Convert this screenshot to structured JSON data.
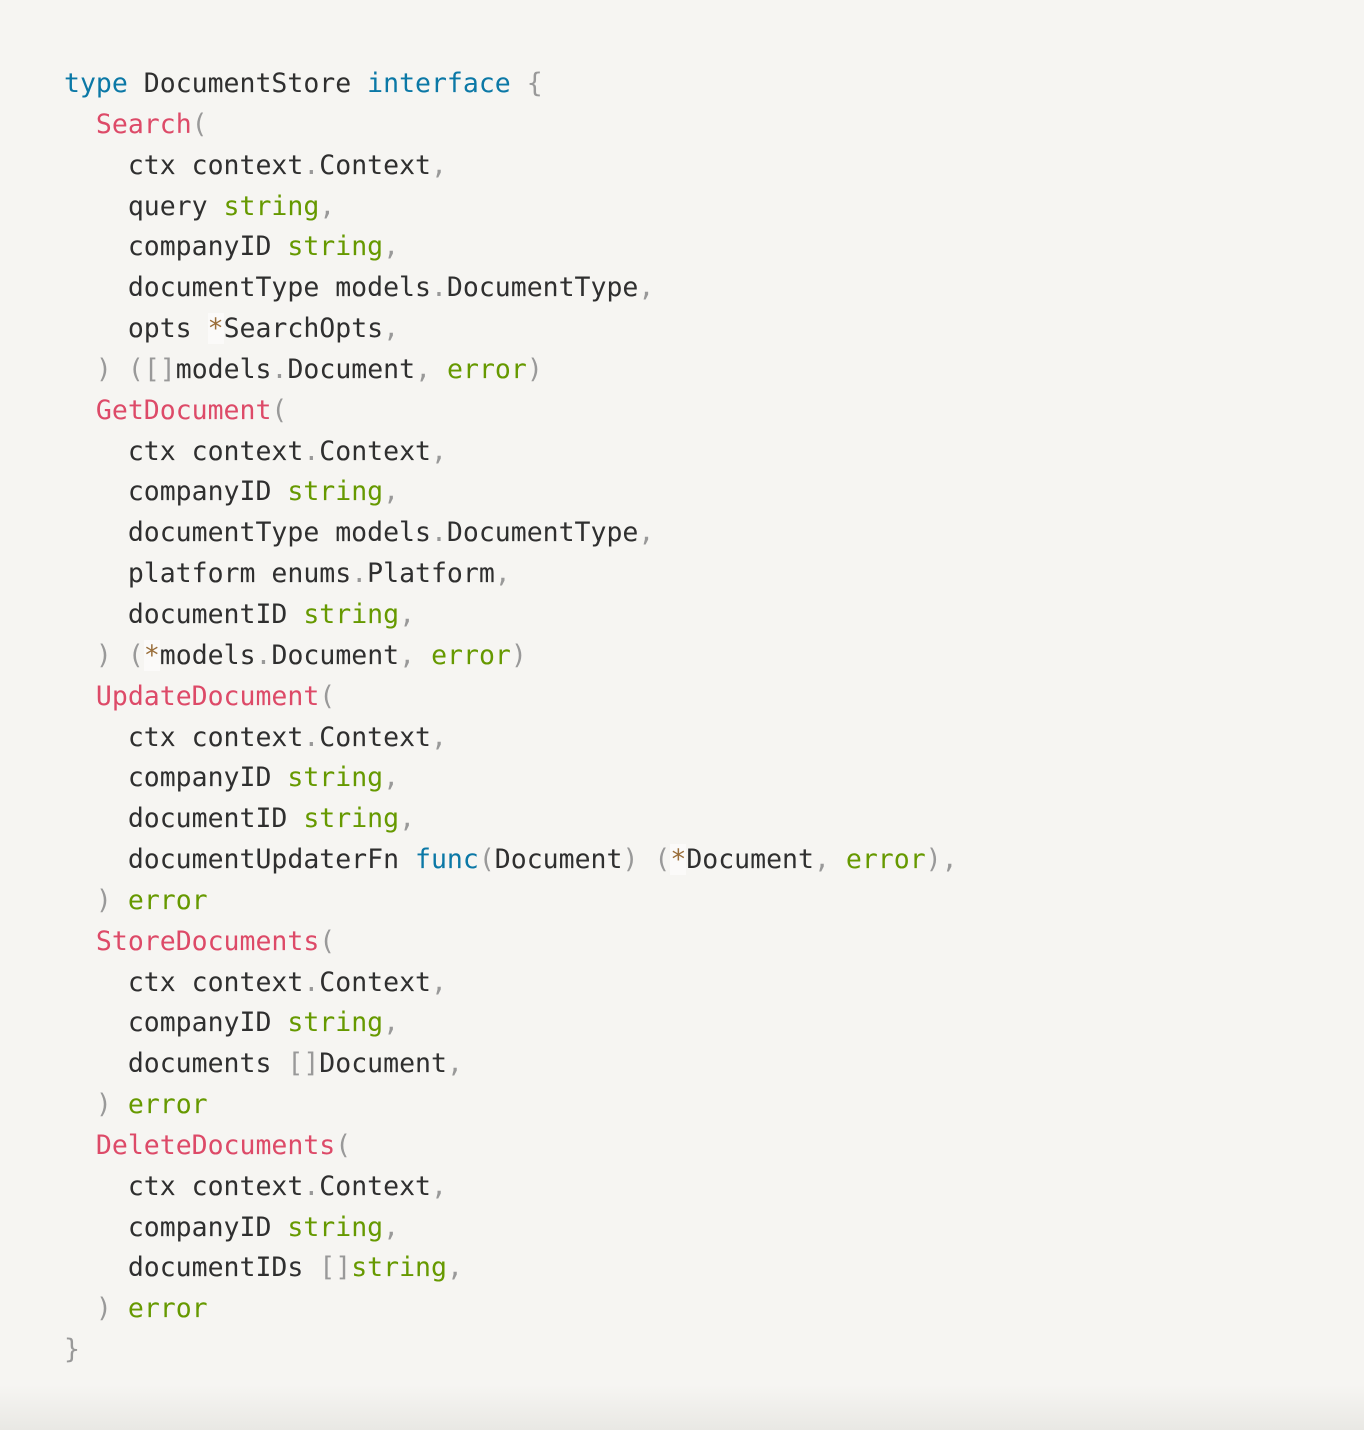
{
  "code": {
    "language": "go",
    "lines": [
      [
        [
          "kw",
          "type"
        ],
        [
          "tx",
          " DocumentStore "
        ],
        [
          "kw",
          "interface"
        ],
        [
          "tx",
          " "
        ],
        [
          "pn",
          "{"
        ]
      ],
      [
        [
          "tx",
          "  "
        ],
        [
          "fn",
          "Search"
        ],
        [
          "pn",
          "("
        ]
      ],
      [
        [
          "tx",
          "    ctx context"
        ],
        [
          "pn",
          "."
        ],
        [
          "tx",
          "Context"
        ],
        [
          "pn",
          ","
        ]
      ],
      [
        [
          "tx",
          "    query "
        ],
        [
          "bt",
          "string"
        ],
        [
          "pn",
          ","
        ]
      ],
      [
        [
          "tx",
          "    companyID "
        ],
        [
          "bt",
          "string"
        ],
        [
          "pn",
          ","
        ]
      ],
      [
        [
          "tx",
          "    documentType models"
        ],
        [
          "pn",
          "."
        ],
        [
          "tx",
          "DocumentType"
        ],
        [
          "pn",
          ","
        ]
      ],
      [
        [
          "tx",
          "    opts "
        ],
        [
          "op",
          "*"
        ],
        [
          "tx",
          "SearchOpts"
        ],
        [
          "pn",
          ","
        ]
      ],
      [
        [
          "tx",
          "  "
        ],
        [
          "pn",
          ")"
        ],
        [
          "tx",
          " "
        ],
        [
          "pn",
          "("
        ],
        [
          "pn",
          "[]"
        ],
        [
          "tx",
          "models"
        ],
        [
          "pn",
          "."
        ],
        [
          "tx",
          "Document"
        ],
        [
          "pn",
          ","
        ],
        [
          "tx",
          " "
        ],
        [
          "bt",
          "error"
        ],
        [
          "pn",
          ")"
        ]
      ],
      [
        [
          "tx",
          "  "
        ],
        [
          "fn",
          "GetDocument"
        ],
        [
          "pn",
          "("
        ]
      ],
      [
        [
          "tx",
          "    ctx context"
        ],
        [
          "pn",
          "."
        ],
        [
          "tx",
          "Context"
        ],
        [
          "pn",
          ","
        ]
      ],
      [
        [
          "tx",
          "    companyID "
        ],
        [
          "bt",
          "string"
        ],
        [
          "pn",
          ","
        ]
      ],
      [
        [
          "tx",
          "    documentType models"
        ],
        [
          "pn",
          "."
        ],
        [
          "tx",
          "DocumentType"
        ],
        [
          "pn",
          ","
        ]
      ],
      [
        [
          "tx",
          "    platform enums"
        ],
        [
          "pn",
          "."
        ],
        [
          "tx",
          "Platform"
        ],
        [
          "pn",
          ","
        ]
      ],
      [
        [
          "tx",
          "    documentID "
        ],
        [
          "bt",
          "string"
        ],
        [
          "pn",
          ","
        ]
      ],
      [
        [
          "tx",
          "  "
        ],
        [
          "pn",
          ")"
        ],
        [
          "tx",
          " "
        ],
        [
          "pn",
          "("
        ],
        [
          "op",
          "*"
        ],
        [
          "tx",
          "models"
        ],
        [
          "pn",
          "."
        ],
        [
          "tx",
          "Document"
        ],
        [
          "pn",
          ","
        ],
        [
          "tx",
          " "
        ],
        [
          "bt",
          "error"
        ],
        [
          "pn",
          ")"
        ]
      ],
      [
        [
          "tx",
          "  "
        ],
        [
          "fn",
          "UpdateDocument"
        ],
        [
          "pn",
          "("
        ]
      ],
      [
        [
          "tx",
          "    ctx context"
        ],
        [
          "pn",
          "."
        ],
        [
          "tx",
          "Context"
        ],
        [
          "pn",
          ","
        ]
      ],
      [
        [
          "tx",
          "    companyID "
        ],
        [
          "bt",
          "string"
        ],
        [
          "pn",
          ","
        ]
      ],
      [
        [
          "tx",
          "    documentID "
        ],
        [
          "bt",
          "string"
        ],
        [
          "pn",
          ","
        ]
      ],
      [
        [
          "tx",
          "    documentUpdaterFn "
        ],
        [
          "kw",
          "func"
        ],
        [
          "pn",
          "("
        ],
        [
          "tx",
          "Document"
        ],
        [
          "pn",
          ")"
        ],
        [
          "tx",
          " "
        ],
        [
          "pn",
          "("
        ],
        [
          "op",
          "*"
        ],
        [
          "tx",
          "Document"
        ],
        [
          "pn",
          ","
        ],
        [
          "tx",
          " "
        ],
        [
          "bt",
          "error"
        ],
        [
          "pn",
          ")"
        ],
        [
          "pn",
          ","
        ]
      ],
      [
        [
          "tx",
          "  "
        ],
        [
          "pn",
          ")"
        ],
        [
          "tx",
          " "
        ],
        [
          "bt",
          "error"
        ]
      ],
      [
        [
          "tx",
          "  "
        ],
        [
          "fn",
          "StoreDocuments"
        ],
        [
          "pn",
          "("
        ]
      ],
      [
        [
          "tx",
          "    ctx context"
        ],
        [
          "pn",
          "."
        ],
        [
          "tx",
          "Context"
        ],
        [
          "pn",
          ","
        ]
      ],
      [
        [
          "tx",
          "    companyID "
        ],
        [
          "bt",
          "string"
        ],
        [
          "pn",
          ","
        ]
      ],
      [
        [
          "tx",
          "    documents "
        ],
        [
          "pn",
          "[]"
        ],
        [
          "tx",
          "Document"
        ],
        [
          "pn",
          ","
        ]
      ],
      [
        [
          "tx",
          "  "
        ],
        [
          "pn",
          ")"
        ],
        [
          "tx",
          " "
        ],
        [
          "bt",
          "error"
        ]
      ],
      [
        [
          "tx",
          "  "
        ],
        [
          "fn",
          "DeleteDocuments"
        ],
        [
          "pn",
          "("
        ]
      ],
      [
        [
          "tx",
          "    ctx context"
        ],
        [
          "pn",
          "."
        ],
        [
          "tx",
          "Context"
        ],
        [
          "pn",
          ","
        ]
      ],
      [
        [
          "tx",
          "    companyID "
        ],
        [
          "bt",
          "string"
        ],
        [
          "pn",
          ","
        ]
      ],
      [
        [
          "tx",
          "    documentIDs "
        ],
        [
          "pn",
          "[]"
        ],
        [
          "bt",
          "string"
        ],
        [
          "pn",
          ","
        ]
      ],
      [
        [
          "tx",
          "  "
        ],
        [
          "pn",
          ")"
        ],
        [
          "tx",
          " "
        ],
        [
          "bt",
          "error"
        ]
      ],
      [
        [
          "pn",
          "}"
        ]
      ]
    ]
  },
  "token_styles": {
    "kw": {
      "name": "keyword",
      "color": "#0b78a6"
    },
    "fn": {
      "name": "function-name",
      "color": "#dd4a68"
    },
    "bt": {
      "name": "builtin-type",
      "color": "#669900"
    },
    "pn": {
      "name": "punctuation",
      "color": "#999999"
    },
    "op": {
      "name": "operator",
      "color": "#9a6e3a"
    },
    "tx": {
      "name": "plain-text",
      "color": "#2f2f2f"
    }
  },
  "colors": {
    "background": "#f6f5f2"
  }
}
